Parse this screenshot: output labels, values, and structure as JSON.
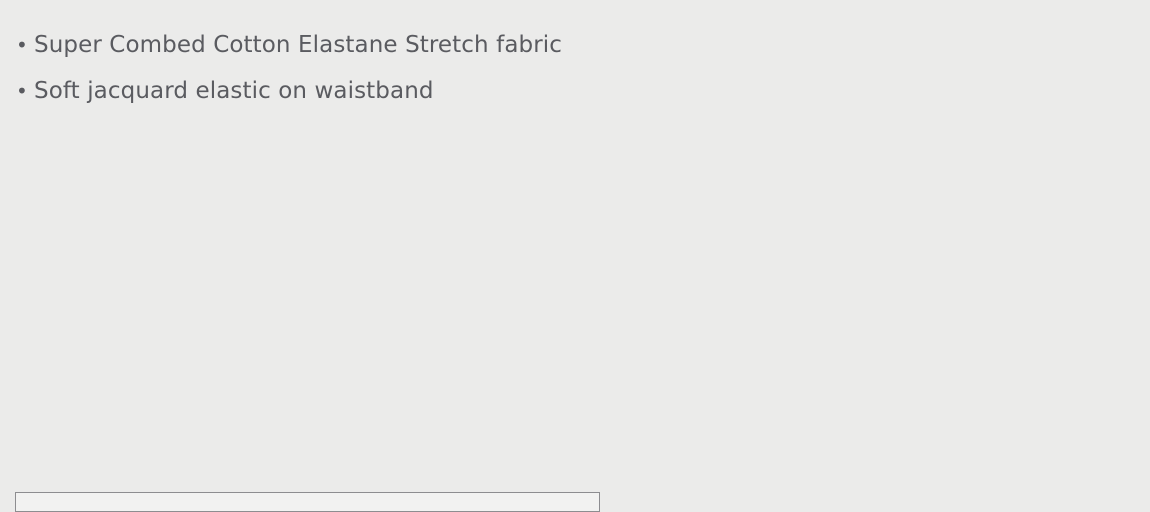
{
  "product": {
    "features": [
      "Super Combed Cotton Elastane Stretch fabric",
      "Soft jacquard elastic on waistband"
    ]
  },
  "colors": {
    "background": "#ebebea",
    "text": "#5a5b60",
    "border": "#8d8d90"
  }
}
